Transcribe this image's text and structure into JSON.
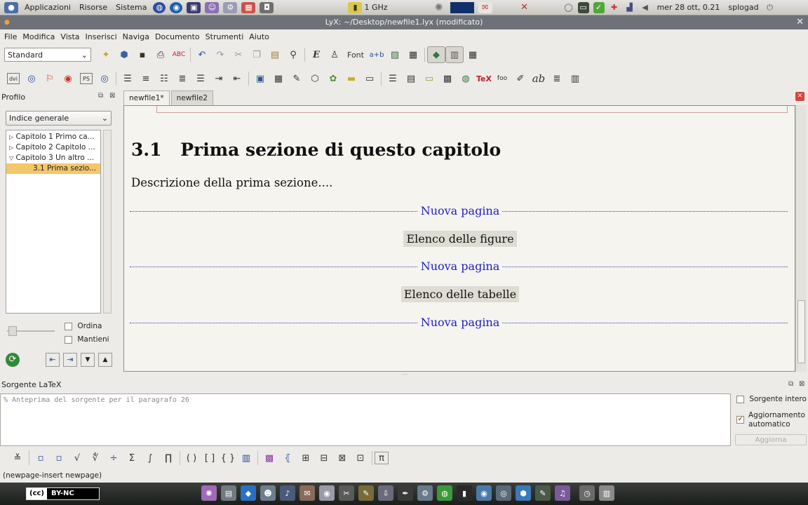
{
  "topbar": {
    "menus": [
      "Applicazioni",
      "Risorse",
      "Sistema"
    ],
    "cpu": "1 GHz",
    "clock": "mer 28 ott, 0.21",
    "user": "splogad"
  },
  "window": {
    "title": "LyX: ~/Desktop/newfile1.lyx (modificato)"
  },
  "menubar": [
    "File",
    "Modifica",
    "Vista",
    "Inserisci",
    "Naviga",
    "Documento",
    "Strumenti",
    "Aiuto"
  ],
  "toolbar": {
    "style_select": "Standard",
    "font_label": "Font"
  },
  "outline": {
    "title": "Profilo",
    "select": "Indice generale",
    "items": [
      {
        "arrow": "▷",
        "label": "Capitolo 1 Primo ca..."
      },
      {
        "arrow": "▷",
        "label": "Capitolo 2 Capitolo ..."
      },
      {
        "arrow": "▽",
        "label": "Capitolo 3 Un altro ..."
      },
      {
        "arrow": "",
        "label": "3.1 Prima sezio..."
      }
    ],
    "sort_label": "Ordina",
    "keep_label": "Mantieni"
  },
  "tabs": [
    "newfile1*",
    "newfile2"
  ],
  "document": {
    "section_number": "3.1",
    "section_title": "Prima sezione di questo capitolo",
    "paragraph": "Descrizione della prima sezione....",
    "new_page": "Nuova pagina",
    "list_figures": "Elenco delle figure",
    "list_tables": "Elenco delle tabelle"
  },
  "latex_source": {
    "title": "Sorgente LaTeX",
    "content": "% Anteprima del sorgente per il paragrafo 26",
    "full_source": "Sorgente intero",
    "auto_update": "Aggiornamento automatico",
    "update_button": "Aggiorna"
  },
  "status": "(newpage-insert newpage)",
  "taskbar": {
    "badge": "BY-NC"
  }
}
